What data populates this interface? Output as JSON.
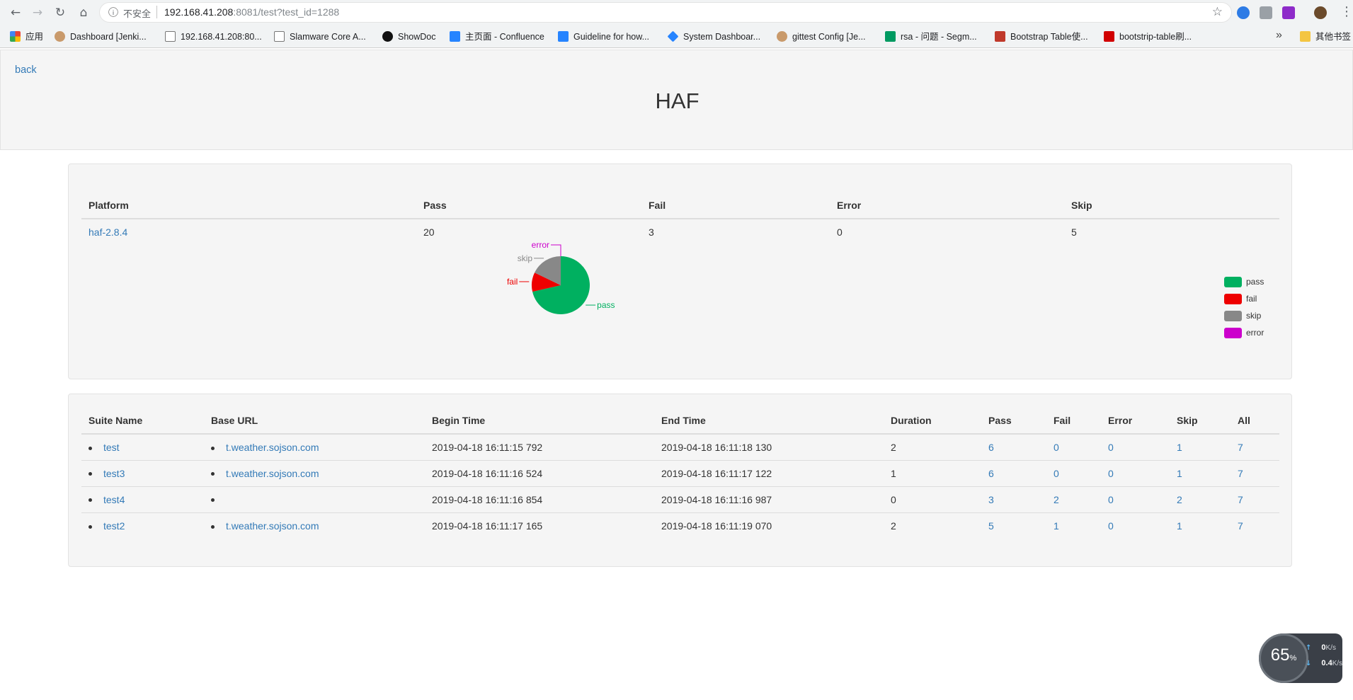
{
  "browser": {
    "insecure_label": "不安全",
    "url_host": "192.168.41.208",
    "url_rest": ":8081/test?test_id=1288",
    "bookmarks": [
      {
        "label": "应用",
        "icon": "apps-grid-icon"
      },
      {
        "label": "Dashboard [Jenki...",
        "icon": "jenkins-icon"
      },
      {
        "label": "192.168.41.208:80...",
        "icon": "page-icon"
      },
      {
        "label": "Slamware Core A...",
        "icon": "page-icon"
      },
      {
        "label": "ShowDoc",
        "icon": "showdoc-icon"
      },
      {
        "label": "主页面 - Confluence",
        "icon": "confluence-icon"
      },
      {
        "label": "Guideline for how...",
        "icon": "confluence-icon"
      },
      {
        "label": "System Dashboar...",
        "icon": "jira-icon"
      },
      {
        "label": "gittest Config [Je...",
        "icon": "jenkins-icon"
      },
      {
        "label": "rsa - 问题 - Segm...",
        "icon": "segmentfault-icon"
      },
      {
        "label": "Bootstrap Table使...",
        "icon": "bootstrap-icon"
      },
      {
        "label": "bootstrip-table刷...",
        "icon": "csdn-icon"
      }
    ],
    "other_bookmarks": "其他书签"
  },
  "header": {
    "back_label": "back",
    "title": "HAF"
  },
  "summary": {
    "columns": [
      "Platform",
      "Pass",
      "Fail",
      "Error",
      "Skip"
    ],
    "row": {
      "platform": "haf-2.8.4",
      "pass": "20",
      "fail": "3",
      "error": "0",
      "skip": "5"
    }
  },
  "chart_data": {
    "type": "pie",
    "slices": [
      {
        "label": "pass",
        "value": 20,
        "color": "#00b060"
      },
      {
        "label": "fail",
        "value": 3,
        "color": "#ee0000"
      },
      {
        "label": "skip",
        "value": 5,
        "color": "#888888"
      },
      {
        "label": "error",
        "value": 0,
        "color": "#cc00cc"
      }
    ],
    "legend": "right"
  },
  "suites": {
    "columns": [
      "Suite Name",
      "Base URL",
      "Begin Time",
      "End Time",
      "Duration",
      "Pass",
      "Fail",
      "Error",
      "Skip",
      "All"
    ],
    "rows": [
      {
        "name": "test",
        "base_url": "t.weather.sojson.com",
        "begin": "2019-04-18 16:11:15 792",
        "end": "2019-04-18 16:11:18 130",
        "duration": "2",
        "pass": "6",
        "fail": "0",
        "error": "0",
        "skip": "1",
        "all": "7"
      },
      {
        "name": "test3",
        "base_url": "t.weather.sojson.com",
        "begin": "2019-04-18 16:11:16 524",
        "end": "2019-04-18 16:11:17 122",
        "duration": "1",
        "pass": "6",
        "fail": "0",
        "error": "0",
        "skip": "1",
        "all": "7"
      },
      {
        "name": "test4",
        "base_url": "",
        "begin": "2019-04-18 16:11:16 854",
        "end": "2019-04-18 16:11:16 987",
        "duration": "0",
        "pass": "3",
        "fail": "2",
        "error": "0",
        "skip": "2",
        "all": "7"
      },
      {
        "name": "test2",
        "base_url": "t.weather.sojson.com",
        "begin": "2019-04-18 16:11:17 165",
        "end": "2019-04-18 16:11:19 070",
        "duration": "2",
        "pass": "5",
        "fail": "1",
        "error": "0",
        "skip": "1",
        "all": "7"
      }
    ]
  },
  "speed_widget": {
    "percent": "65",
    "percent_unit": "%",
    "up": "0",
    "down": "0.4",
    "unit": "K/s"
  }
}
